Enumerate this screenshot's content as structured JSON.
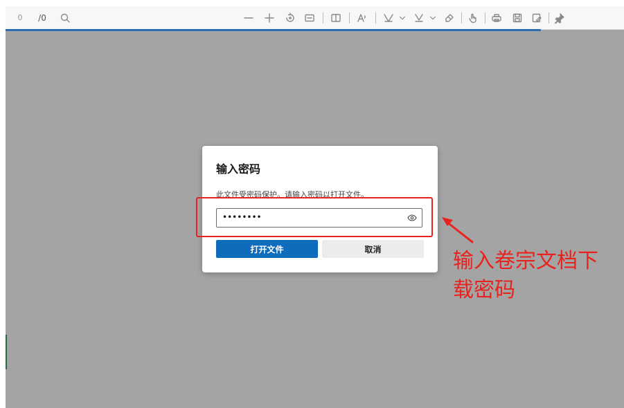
{
  "toolbar": {
    "page_current": "0",
    "page_total": "/0",
    "icons": [
      "search-icon",
      "zoom-out-icon",
      "zoom-in-icon",
      "rotate-icon",
      "fit-page-icon",
      "page-view-icon",
      "read-aloud-icon",
      "draw-icon",
      "draw-dropdown-icon",
      "highlight-icon",
      "highlight-dropdown-icon",
      "erase-icon",
      "touch-icon",
      "print-icon",
      "save-icon",
      "save-as-icon",
      "pin-icon"
    ]
  },
  "dialog": {
    "title": "输入密码",
    "description": "此文件受密码保护。请输入密码以打开文件。",
    "password_value": "••••••••",
    "open_button": "打开文件",
    "cancel_button": "取消"
  },
  "annotation": {
    "line1": "输入卷宗文档下",
    "line2": "载密码",
    "color": "#e8231e"
  },
  "colors": {
    "accent": "#0f6cbd",
    "progress": "#2f6db5",
    "backdrop": "#a4a4a4"
  }
}
